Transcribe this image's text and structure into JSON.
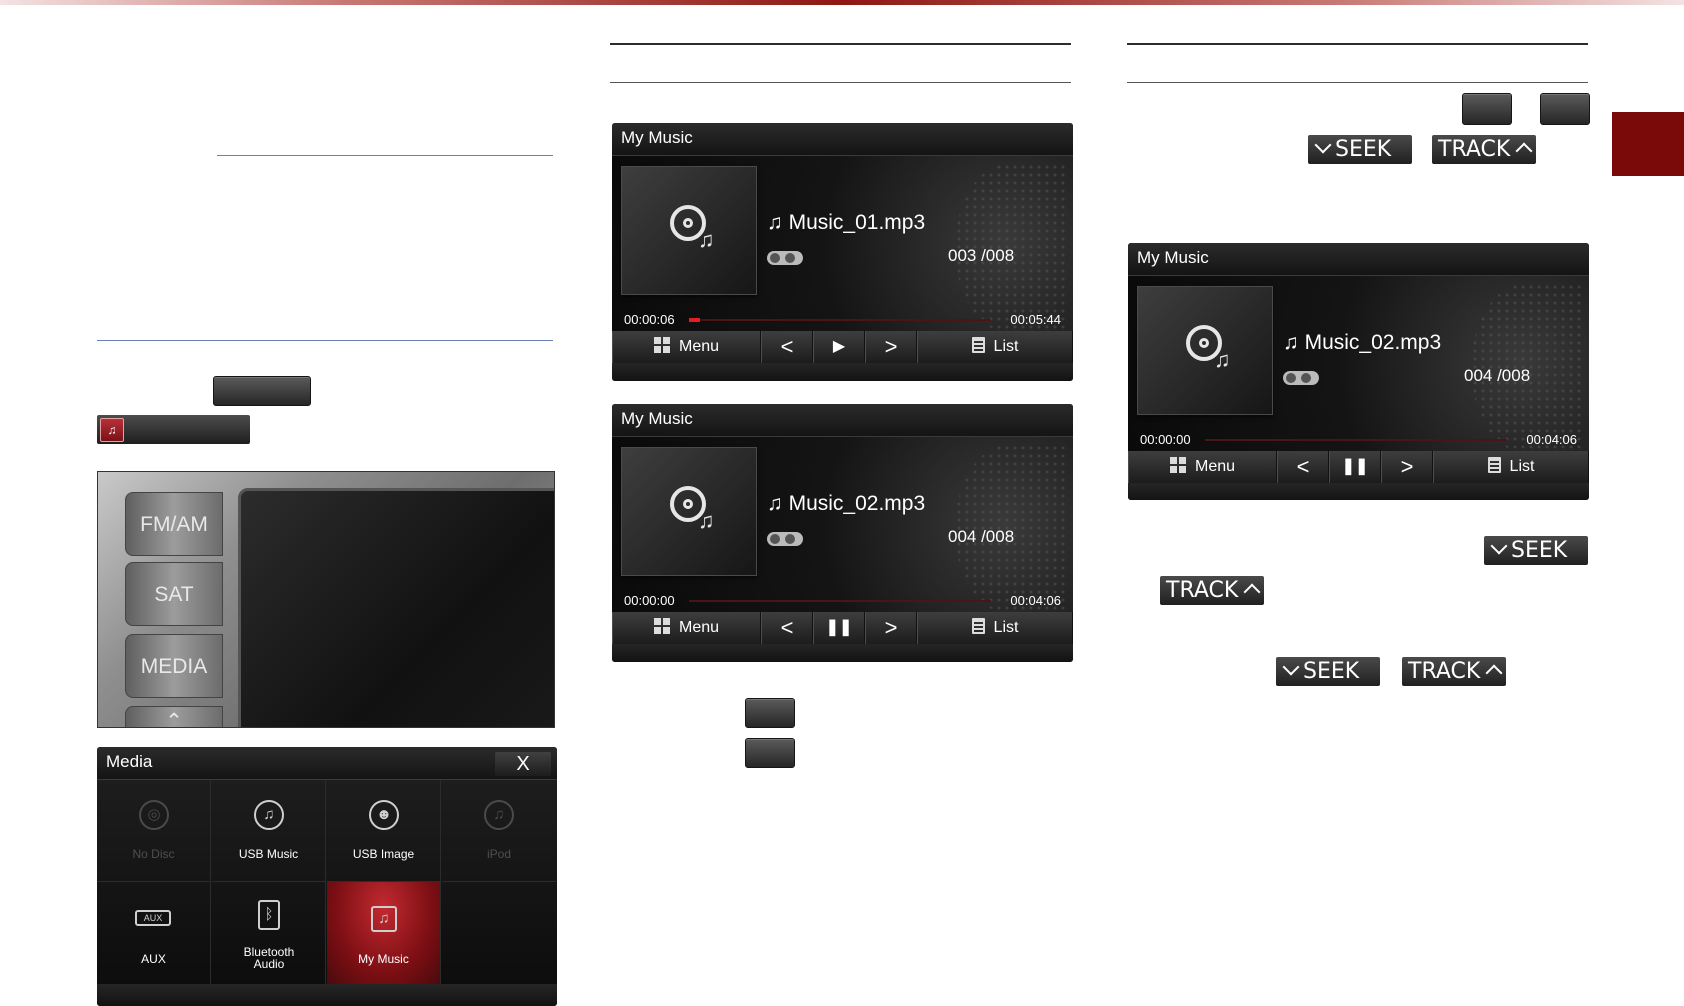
{
  "doc": {
    "media_key_label": "",
    "hardware_keys": [
      "FM/AM",
      "SAT",
      "MEDIA"
    ],
    "seek_label": "SEEK",
    "track_label": "TRACK",
    "colors": {
      "accent": "#7a0a0a",
      "rule_blue": "#27488f",
      "progress": "#e02020"
    }
  },
  "screens": [
    {
      "title": "My Music",
      "track": "Music_01.mp3",
      "count": "003 /008",
      "time_elapsed": "00:00:06",
      "time_total": "00:05:44",
      "progress": 0.02,
      "play_icon": "play-icon",
      "menu_label": "Menu",
      "list_label": "List"
    },
    {
      "title": "My Music",
      "track": "Music_02.mp3",
      "count": "004 /008",
      "time_elapsed": "00:00:00",
      "time_total": "00:04:06",
      "progress": 0,
      "play_icon": "pause-icon",
      "menu_label": "Menu",
      "list_label": "List"
    },
    {
      "title": "My Music",
      "track": "Music_02.mp3",
      "count": "004 /008",
      "time_elapsed": "00:00:00",
      "time_total": "00:04:06",
      "progress": 0,
      "play_icon": "pause-icon",
      "menu_label": "Menu",
      "list_label": "List"
    }
  ],
  "media_menu": {
    "title": "Media",
    "close_label": "X",
    "items": [
      {
        "label": "No Disc",
        "icon": "disc-icon",
        "enabled": false,
        "selected": false
      },
      {
        "label": "USB Music",
        "icon": "usb-music-icon",
        "enabled": true,
        "selected": false
      },
      {
        "label": "USB Image",
        "icon": "usb-image-icon",
        "enabled": true,
        "selected": false
      },
      {
        "label": "iPod",
        "icon": "ipod-icon",
        "enabled": false,
        "selected": false
      },
      {
        "label": "AUX",
        "icon": "aux-icon",
        "enabled": true,
        "selected": false
      },
      {
        "label": "Bluetooth Audio",
        "icon": "bluetooth-icon",
        "enabled": true,
        "selected": false
      },
      {
        "label": "My Music",
        "icon": "music-note-icon",
        "enabled": true,
        "selected": true
      },
      {
        "label": "",
        "icon": "",
        "enabled": false,
        "selected": false
      }
    ]
  }
}
